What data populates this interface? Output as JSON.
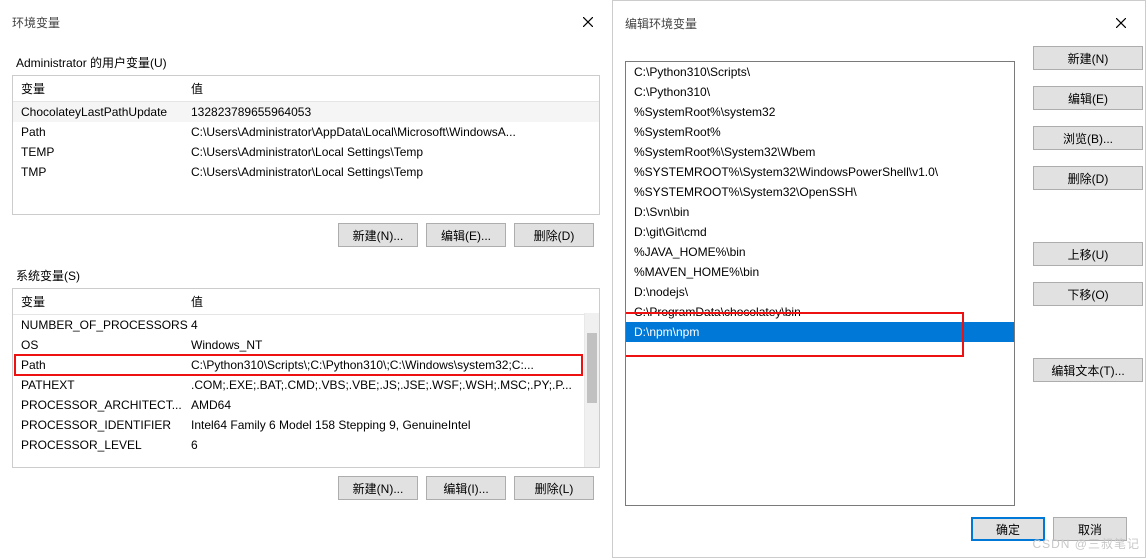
{
  "leftDialog": {
    "title": "环境变量",
    "userVars": {
      "label": "Administrator 的用户变量(U)",
      "headers": {
        "name": "变量",
        "value": "值"
      },
      "rows": [
        {
          "name": "ChocolateyLastPathUpdate",
          "value": "132823789655964053"
        },
        {
          "name": "Path",
          "value": "C:\\Users\\Administrator\\AppData\\Local\\Microsoft\\WindowsA..."
        },
        {
          "name": "TEMP",
          "value": "C:\\Users\\Administrator\\Local Settings\\Temp"
        },
        {
          "name": "TMP",
          "value": "C:\\Users\\Administrator\\Local Settings\\Temp"
        }
      ]
    },
    "sysVars": {
      "label": "系统变量(S)",
      "headers": {
        "name": "变量",
        "value": "值"
      },
      "rows": [
        {
          "name": "NUMBER_OF_PROCESSORS",
          "value": "4"
        },
        {
          "name": "OS",
          "value": "Windows_NT"
        },
        {
          "name": "Path",
          "value": "C:\\Python310\\Scripts\\;C:\\Python310\\;C:\\Windows\\system32;C:..."
        },
        {
          "name": "PATHEXT",
          "value": ".COM;.EXE;.BAT;.CMD;.VBS;.VBE;.JS;.JSE;.WSF;.WSH;.MSC;.PY;.P..."
        },
        {
          "name": "PROCESSOR_ARCHITECT...",
          "value": "AMD64"
        },
        {
          "name": "PROCESSOR_IDENTIFIER",
          "value": "Intel64 Family 6 Model 158 Stepping 9, GenuineIntel"
        },
        {
          "name": "PROCESSOR_LEVEL",
          "value": "6"
        }
      ]
    },
    "buttons": {
      "new": "新建(N)...",
      "edit": "编辑(E)...",
      "delete": "删除(D)",
      "new2": "新建(N)...",
      "edit2": "编辑(I)...",
      "delete2": "删除(L)"
    }
  },
  "rightDialog": {
    "title": "编辑环境变量",
    "pathItems": [
      "C:\\Python310\\Scripts\\",
      "C:\\Python310\\",
      "%SystemRoot%\\system32",
      "%SystemRoot%",
      "%SystemRoot%\\System32\\Wbem",
      "%SYSTEMROOT%\\System32\\WindowsPowerShell\\v1.0\\",
      "%SYSTEMROOT%\\System32\\OpenSSH\\",
      "D:\\Svn\\bin",
      "D:\\git\\Git\\cmd",
      "%JAVA_HOME%\\bin",
      "%MAVEN_HOME%\\bin",
      "D:\\nodejs\\",
      "C:\\ProgramData\\chocolatey\\bin",
      "D:\\npm\\npm"
    ],
    "selectedIndex": 13,
    "redBoxStart": 12,
    "redBoxEnd": 13,
    "buttons": {
      "new": "新建(N)",
      "edit": "编辑(E)",
      "browse": "浏览(B)...",
      "delete": "删除(D)",
      "up": "上移(U)",
      "down": "下移(O)",
      "editText": "编辑文本(T)...",
      "ok": "确定",
      "cancel": "取消"
    }
  },
  "watermark": "CSDN @三叔笔记"
}
